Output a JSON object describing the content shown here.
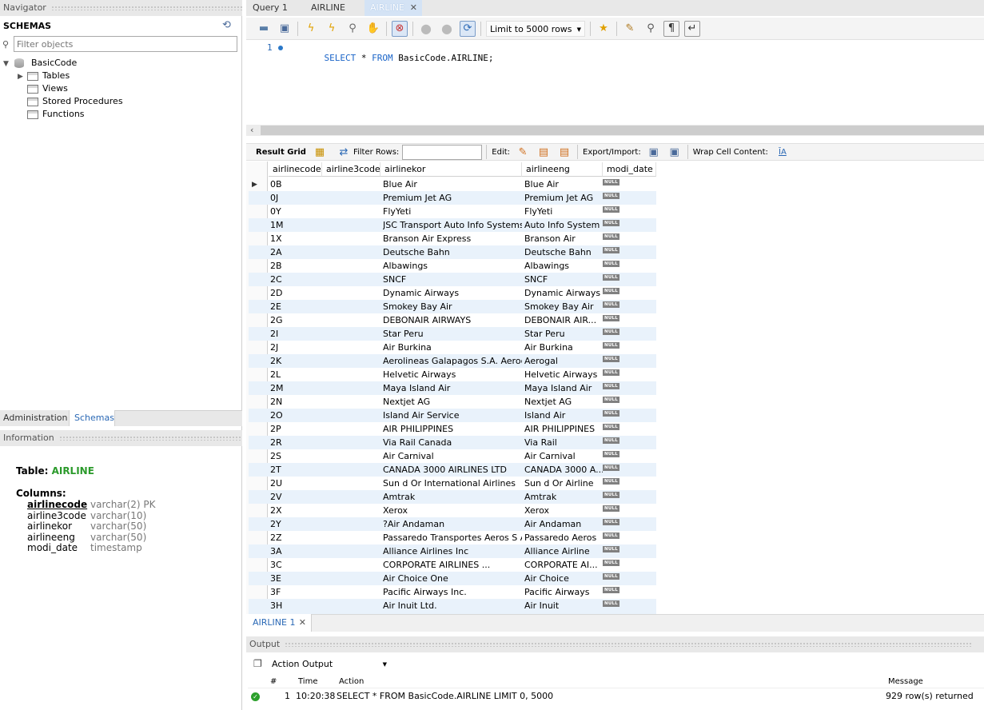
{
  "navigator": {
    "title": "Navigator",
    "schemas_label": "SCHEMAS",
    "filter_placeholder": "Filter objects",
    "schema": "BasicCode",
    "children": [
      "Tables",
      "Views",
      "Stored Procedures",
      "Functions"
    ]
  },
  "left_tabs": [
    "Administration",
    "Schemas"
  ],
  "information": {
    "title": "Information",
    "table_prefix": "Table: ",
    "table_name": "AIRLINE",
    "columns_label": "Columns:",
    "columns": [
      {
        "name": "airlinecode",
        "type": "varchar(2) PK"
      },
      {
        "name": "airline3code",
        "type": "varchar(10)"
      },
      {
        "name": "airlinekor",
        "type": "varchar(50)"
      },
      {
        "name": "airlineeng",
        "type": "varchar(50)"
      },
      {
        "name": "modi_date",
        "type": "timestamp"
      }
    ]
  },
  "editor_tabs": [
    "Query 1",
    "AIRLINE",
    "AIRLINE"
  ],
  "toolbar": {
    "limit": "Limit to 5000 rows"
  },
  "editor": {
    "line_number": "1",
    "sql": [
      {
        "t": "SELECT",
        "k": true
      },
      {
        "t": " * ",
        "k": false
      },
      {
        "t": "FROM",
        "k": true
      },
      {
        "t": " BasicCode.AIRLINE;",
        "k": false
      }
    ]
  },
  "result_toolbar": {
    "result_grid": "Result Grid",
    "filter_rows": "Filter Rows:",
    "edit": "Edit:",
    "export_import": "Export/Import:",
    "wrap": "Wrap Cell Content:"
  },
  "grid": {
    "columns": [
      "airlinecode",
      "airline3code",
      "airlinekor",
      "airlineeng",
      "modi_date"
    ],
    "null_label": "NULL",
    "rows": [
      [
        "0B",
        "",
        "Blue Air",
        "Blue Air"
      ],
      [
        "0J",
        "",
        "Premium Jet AG",
        "Premium Jet AG"
      ],
      [
        "0Y",
        "",
        "FlyYeti",
        "FlyYeti"
      ],
      [
        "1M",
        "",
        "JSC Transport Auto Info Systems",
        "Auto Info System"
      ],
      [
        "1X",
        "",
        "Branson Air Express",
        "Branson Air"
      ],
      [
        "2A",
        "",
        "Deutsche Bahn",
        "Deutsche Bahn"
      ],
      [
        "2B",
        "",
        "Albawings",
        "Albawings"
      ],
      [
        "2C",
        "",
        "SNCF",
        "SNCF"
      ],
      [
        "2D",
        "",
        "Dynamic Airways",
        "Dynamic Airways"
      ],
      [
        "2E",
        "",
        "Smokey Bay Air",
        "Smokey Bay Air"
      ],
      [
        "2G",
        "",
        "DEBONAIR AIRWAYS",
        "DEBONAIR AIR..."
      ],
      [
        "2I",
        "",
        "Star Peru",
        "Star Peru"
      ],
      [
        "2J",
        "",
        "Air Burkina",
        "Air Burkina"
      ],
      [
        "2K",
        "",
        "Aerolineas Galapagos S.A. Aerogal",
        "Aerogal"
      ],
      [
        "2L",
        "",
        "Helvetic Airways",
        "Helvetic Airways"
      ],
      [
        "2M",
        "",
        "Maya Island Air",
        "Maya Island Air"
      ],
      [
        "2N",
        "",
        "Nextjet AG",
        "Nextjet AG"
      ],
      [
        "2O",
        "",
        "Island Air Service",
        "Island Air"
      ],
      [
        "2P",
        "",
        "AIR PHILIPPINES",
        "AIR PHILIPPINES"
      ],
      [
        "2R",
        "",
        "Via Rail Canada",
        "Via Rail"
      ],
      [
        "2S",
        "",
        "Air Carnival",
        "Air Carnival"
      ],
      [
        "2T",
        "",
        "CANADA 3000 AIRLINES LTD",
        "CANADA 3000 A..."
      ],
      [
        "2U",
        "",
        "Sun d Or International Airlines",
        "Sun d Or Airline"
      ],
      [
        "2V",
        "",
        "Amtrak",
        "Amtrak"
      ],
      [
        "2X",
        "",
        "Xerox",
        "Xerox"
      ],
      [
        "2Y",
        "",
        "?Air Andaman",
        "Air Andaman"
      ],
      [
        "2Z",
        "",
        "Passaredo Transportes Aeros S A",
        "Passaredo Aeros"
      ],
      [
        "3A",
        "",
        "Alliance Airlines Inc",
        "Alliance Airline"
      ],
      [
        "3C",
        "",
        "CORPORATE AIRLINES          ...",
        "CORPORATE AI..."
      ],
      [
        "3E",
        "",
        "Air Choice One",
        "Air Choice"
      ],
      [
        "3F",
        "",
        "Pacific Airways Inc.",
        "Pacific Airways"
      ],
      [
        "3H",
        "",
        "Air Inuit Ltd.",
        "Air Inuit"
      ]
    ]
  },
  "result_tab": "AIRLINE 1",
  "output": {
    "title": "Output",
    "selector": "Action Output",
    "headers": {
      "num": "#",
      "time": "Time",
      "action": "Action",
      "message": "Message"
    },
    "row": {
      "num": "1",
      "time": "10:20:38",
      "action": "SELECT * FROM BasicCode.AIRLINE LIMIT 0, 5000",
      "message": "929 row(s) returned"
    }
  },
  "colors": {
    "accent": "#0f4d9c",
    "table_green": "#2b9a2b",
    "keyword": "#1a64c8",
    "success": "#2ca02c"
  }
}
